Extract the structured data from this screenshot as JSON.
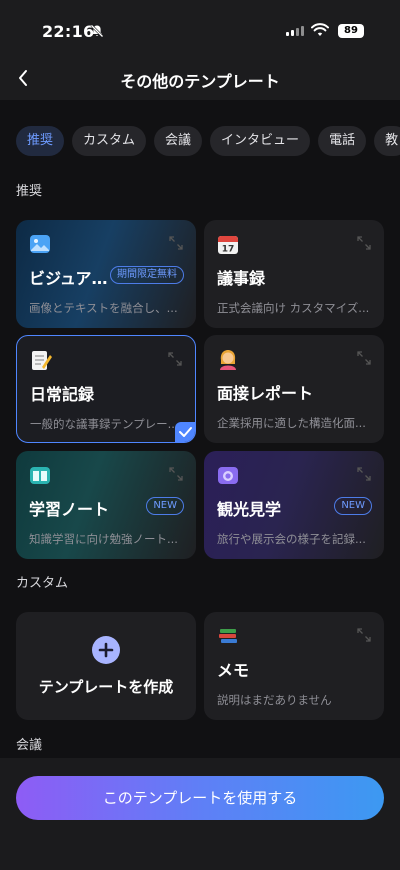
{
  "status": {
    "time": "22:16",
    "battery": "89"
  },
  "nav": {
    "title": "その他のテンプレート"
  },
  "chips": [
    "推奨",
    "カスタム",
    "会議",
    "インタビュー",
    "電話",
    "教"
  ],
  "sections": {
    "recommended": "推奨",
    "custom": "カスタム",
    "meeting": "会議"
  },
  "cards": [
    {
      "title": "ビジュア…",
      "badge": "期間限定無料",
      "desc": "画像とテキストを融合し、..."
    },
    {
      "title": "議事録",
      "desc": "正式会議向け カスタマイズ..."
    },
    {
      "title": "日常記録",
      "desc": "一般的な議事録テンプレー..."
    },
    {
      "title": "面接レポート",
      "desc": "企業採用に適した構造化面..."
    },
    {
      "title": "学習ノート",
      "badge": "NEW",
      "desc": "知識学習に向け勉強ノート..."
    },
    {
      "title": "観光見学",
      "badge": "NEW",
      "desc": "旅行や展示会の様子を記録..."
    }
  ],
  "custom": {
    "create_label": "テンプレートを作成",
    "memo": {
      "title": "メモ",
      "desc": "説明はまだありません"
    }
  },
  "cta": {
    "label": "このテンプレートを使用する"
  },
  "colors": {
    "accent": "#4f86ff",
    "background": "#111113"
  }
}
